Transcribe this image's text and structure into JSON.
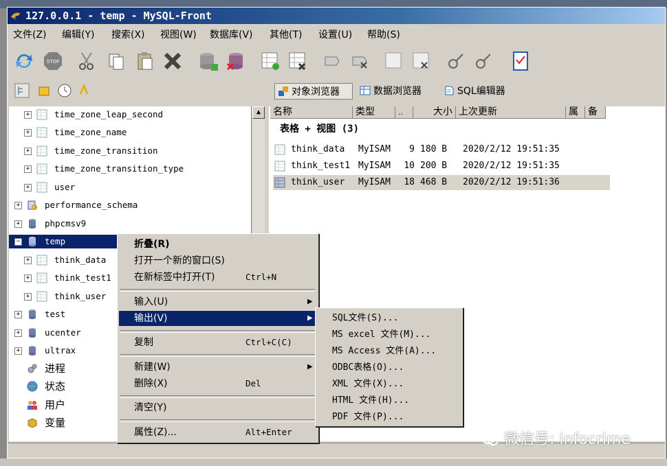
{
  "window": {
    "title": "127.0.0.1 - temp - MySQL-Front"
  },
  "menu": [
    "文件(Z)",
    "编辑(Y)",
    "搜索(X)",
    "视图(W)",
    "数据库(V)",
    "其他(T)",
    "设置(U)",
    "帮助(S)"
  ],
  "toolbar_icons": [
    "refresh-icon",
    "stop-icon",
    "cut-icon",
    "copy-icon",
    "paste-icon",
    "delete-icon",
    "db-add-icon",
    "db-remove-icon",
    "table-add-icon",
    "table-remove-icon",
    "field-add-icon",
    "field-remove-icon",
    "index-add-icon",
    "index-remove-icon",
    "foreign-key-add-icon",
    "foreign-key-remove-icon",
    "checklist-icon"
  ],
  "views": {
    "object_browser": "对象浏览器",
    "data_browser": "数据浏览器",
    "sql_editor": "SQL编辑器"
  },
  "tree": [
    {
      "label": "time_zone_leap_second",
      "level": 2,
      "type": "table"
    },
    {
      "label": "time_zone_name",
      "level": 2,
      "type": "table"
    },
    {
      "label": "time_zone_transition",
      "level": 2,
      "type": "table"
    },
    {
      "label": "time_zone_transition_type",
      "level": 2,
      "type": "table"
    },
    {
      "label": "user",
      "level": 2,
      "type": "table"
    },
    {
      "label": "performance_schema",
      "level": 1,
      "type": "schema"
    },
    {
      "label": "phpcmsv9",
      "level": 1,
      "type": "db"
    },
    {
      "label": "temp",
      "level": 1,
      "type": "db",
      "selected": true,
      "expanded": true
    },
    {
      "label": "think_data",
      "level": 2,
      "type": "table"
    },
    {
      "label": "think_test1",
      "level": 2,
      "type": "table"
    },
    {
      "label": "think_user",
      "level": 2,
      "type": "table"
    },
    {
      "label": "test",
      "level": 1,
      "type": "db"
    },
    {
      "label": "ucenter",
      "level": 1,
      "type": "db"
    },
    {
      "label": "ultrax",
      "level": 1,
      "type": "db"
    },
    {
      "label": "进程",
      "level": 1,
      "type": "process"
    },
    {
      "label": "状态",
      "level": 1,
      "type": "status"
    },
    {
      "label": "用户",
      "level": 1,
      "type": "users"
    },
    {
      "label": "变量",
      "level": 1,
      "type": "vars"
    }
  ],
  "list": {
    "columns": [
      "名称",
      "类型",
      "..",
      "大小",
      "上次更新",
      "属",
      "备"
    ],
    "group": "表格 + 视图 (3)",
    "rows": [
      {
        "name": "think_data",
        "type": "MyISAM",
        "count": "9",
        "size": "180 B",
        "updated": "2020/2/12 19:51:35"
      },
      {
        "name": "think_test1",
        "type": "MyISAM",
        "count": "10",
        "size": "200 B",
        "updated": "2020/2/12 19:51:35"
      },
      {
        "name": "think_user",
        "type": "MyISAM",
        "count": "18",
        "size": "468 B",
        "updated": "2020/2/12 19:51:36",
        "selected": true
      }
    ]
  },
  "context_menu": {
    "collapse": "折叠(R)",
    "open_new_window": "打开一个新的窗口(S)",
    "open_new_tab": "在新标签中打开(T)",
    "open_new_tab_shortcut": "Ctrl+N",
    "import": "输入(U)",
    "export": "输出(V)",
    "copy": "复制",
    "copy_shortcut": "Ctrl+C(C)",
    "new": "新建(W)",
    "delete": "删除(X)",
    "delete_shortcut": "Del",
    "clear": "清空(Y)",
    "properties": "属性(Z)...",
    "properties_shortcut": "Alt+Enter"
  },
  "export_submenu": [
    "SQL文件(S)...",
    "MS excel 文件(M)...",
    "MS Access 文件(A)...",
    "ODBC表格(O)...",
    "XML 文件(X)...",
    "HTML 文件(H)...",
    "PDF 文件(P)..."
  ],
  "watermark": "微信号: infocrime"
}
